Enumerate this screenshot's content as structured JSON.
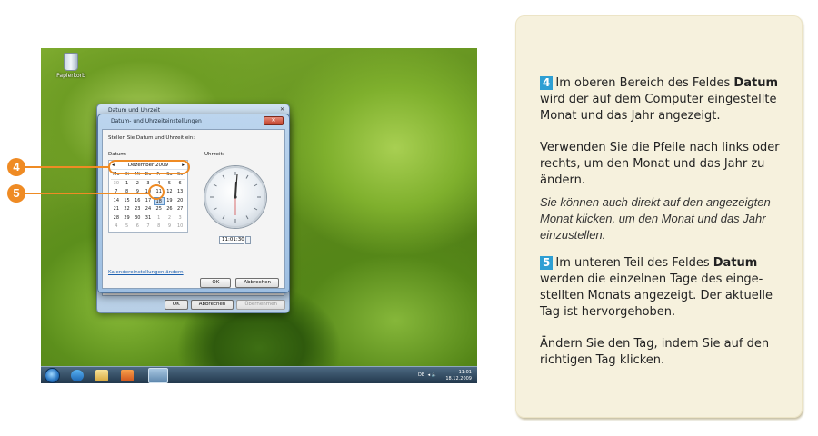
{
  "desktop": {
    "recycle_bin_label": "Papierkorb"
  },
  "outer_dialog": {
    "title": "Datum und Uhrzeit",
    "buttons": {
      "ok": "OK",
      "cancel": "Abbrechen",
      "apply": "Übernehmen"
    }
  },
  "inner_dialog": {
    "title": "Datum- und Uhrzeiteinstellungen",
    "instruction": "Stellen Sie Datum und Uhrzeit ein:",
    "date_label": "Datum:",
    "time_label": "Uhrzeit:",
    "calendar": {
      "month_year": "Dezember 2009",
      "weekdays": [
        "Mo",
        "Di",
        "Mi",
        "Do",
        "Fr",
        "Sa",
        "So"
      ],
      "weeks": [
        [
          "30",
          "1",
          "2",
          "3",
          "4",
          "5",
          "6"
        ],
        [
          "7",
          "8",
          "9",
          "10",
          "11",
          "12",
          "13"
        ],
        [
          "14",
          "15",
          "16",
          "17",
          "18",
          "19",
          "20"
        ],
        [
          "21",
          "22",
          "23",
          "24",
          "25",
          "26",
          "27"
        ],
        [
          "28",
          "29",
          "30",
          "31",
          "1",
          "2",
          "3"
        ],
        [
          "4",
          "5",
          "6",
          "7",
          "8",
          "9",
          "10"
        ]
      ],
      "selected_day": "18"
    },
    "time_value": "11:01:30",
    "calendar_settings_link": "Kalendereinstellungen ändern",
    "buttons": {
      "ok": "OK",
      "cancel": "Abbrechen"
    }
  },
  "taskbar": {
    "language": "DE",
    "clock_time": "11:01",
    "clock_date": "18.12.2009"
  },
  "callouts": {
    "four": "4",
    "five": "5"
  },
  "panel": {
    "p1": {
      "num": "4",
      "pre": "Im oberen Bereich des Feldes ",
      "bold": "Datum",
      "post": " wird der auf dem Computer eingestellte Monat und das Jahr angezeigt."
    },
    "p2": "Verwenden Sie die Pfeile nach links oder rechts, um den Monat und das Jahr zu ändern.",
    "p3": "Sie können auch direkt auf den angezeigten Monat klicken, um den Monat und das Jahr einzustellen.",
    "p4": {
      "num": "5",
      "pre": "Im unteren Teil des Feldes ",
      "bold": "Datum",
      "post": " werden die einzelnen Tage des einge-stellten Monats angezeigt. Der aktuelle Tag ist hervorgehoben."
    },
    "p5": "Ändern Sie den Tag, indem Sie auf den richtigen Tag klicken."
  }
}
